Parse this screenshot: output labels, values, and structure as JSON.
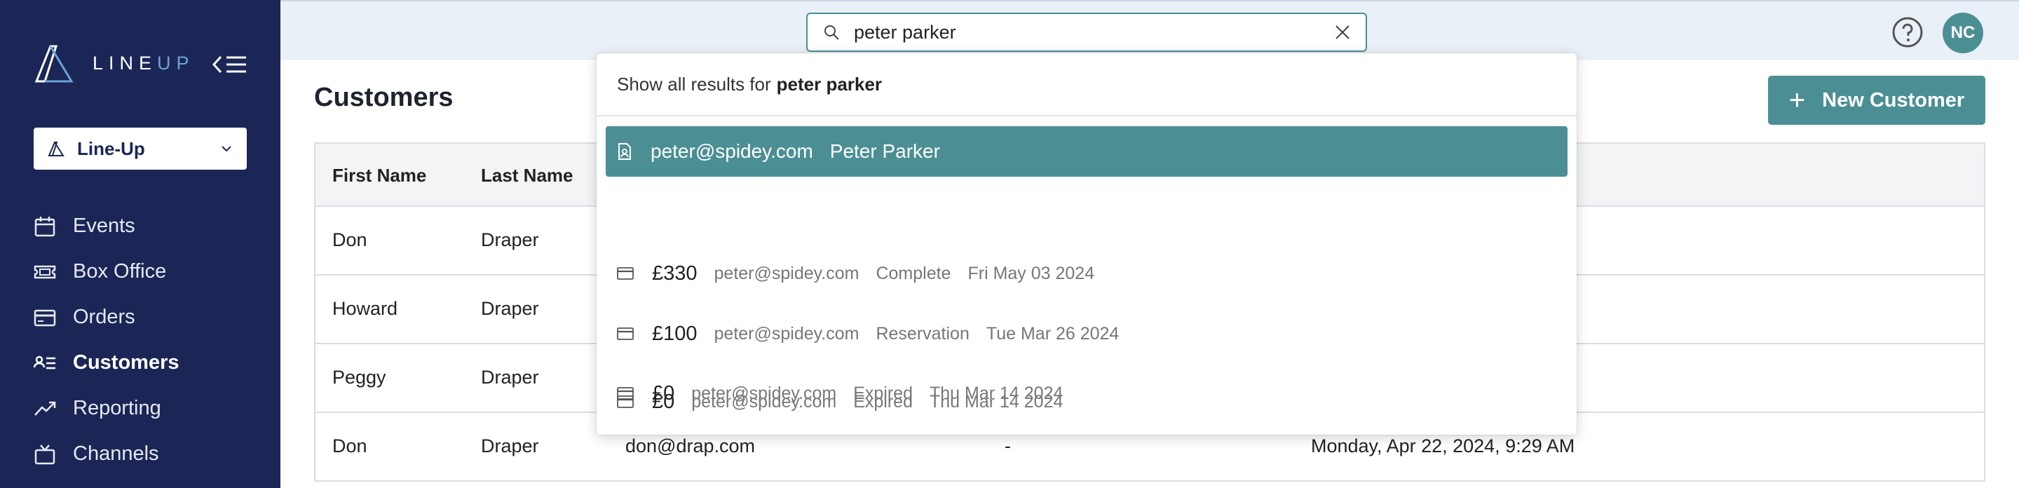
{
  "brand": {
    "logo_text_a": "LINE",
    "logo_text_b": "UP"
  },
  "sidebar": {
    "org": "Line-Up",
    "items": [
      {
        "label": "Events",
        "icon": "calendar-icon",
        "active": false
      },
      {
        "label": "Box Office",
        "icon": "ticket-icon",
        "active": false
      },
      {
        "label": "Orders",
        "icon": "card-icon",
        "active": false
      },
      {
        "label": "Customers",
        "icon": "customer-list-icon",
        "active": true
      },
      {
        "label": "Reporting",
        "icon": "trend-icon",
        "active": false
      },
      {
        "label": "Channels",
        "icon": "tv-icon",
        "active": false
      }
    ]
  },
  "topbar": {
    "search_value": "peter parker",
    "avatar_initials": "NC"
  },
  "main": {
    "title": "Customers",
    "new_button": "New Customer",
    "columns": [
      "First Name",
      "Last Name"
    ],
    "rows": [
      {
        "first": "Don",
        "last": "Draper",
        "email": "",
        "dash": "",
        "date": ""
      },
      {
        "first": "Howard",
        "last": "Draper",
        "email": "",
        "dash": "",
        "date": ""
      },
      {
        "first": "Peggy",
        "last": "Draper",
        "email": "",
        "dash": "",
        "date": ""
      },
      {
        "first": "Don",
        "last": "Draper",
        "email": "don@drap.com",
        "dash": "-",
        "date": "Monday, Apr 22, 2024, 9:29 AM"
      }
    ]
  },
  "dropdown": {
    "show_all_prefix": "Show all results for",
    "show_all_query": "peter parker",
    "customer": {
      "email": "peter@spidey.com",
      "name": "Peter Parker"
    },
    "orders": [
      {
        "amount": "£330",
        "email": "peter@spidey.com",
        "status": "Complete",
        "date": "Fri May 03 2024"
      },
      {
        "amount": "£100",
        "email": "peter@spidey.com",
        "status": "Reservation",
        "date": "Tue Mar 26 2024"
      },
      {
        "amount": "£0",
        "email": "peter@spidey.com",
        "status": "Expired",
        "date": "Thu Mar 14 2024"
      },
      {
        "amount": "£0",
        "email": "peter@spidey.com",
        "status": "Expired",
        "date": "Thu Mar 14 2024"
      }
    ]
  },
  "colors": {
    "sidebar": "#1b2656",
    "accent": "#4b8f94",
    "topbar": "#eaf0f7"
  }
}
